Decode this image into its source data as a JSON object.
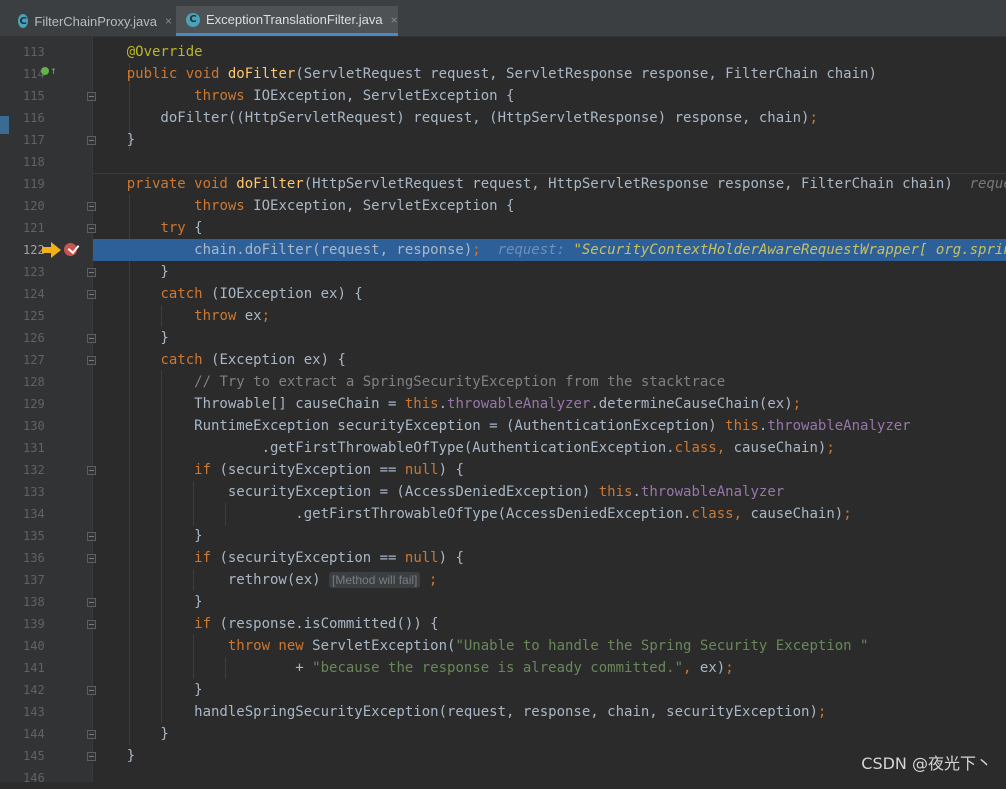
{
  "tabs": [
    {
      "label": "FilterChainProxy.java",
      "icon": "java-class-icon",
      "icon_letter": "C",
      "active": false
    },
    {
      "label": "ExceptionTranslationFilter.java",
      "icon": "java-class-icon",
      "icon_letter": "C",
      "active": true
    }
  ],
  "tab_close_glyph": "×",
  "editor": {
    "current_line": "122",
    "line_numbers": [
      "113",
      "114",
      "115",
      "116",
      "117",
      "118",
      "119",
      "120",
      "121",
      "122",
      "123",
      "124",
      "125",
      "126",
      "127",
      "128",
      "129",
      "130",
      "131",
      "132",
      "133",
      "134",
      "135",
      "136",
      "137",
      "138",
      "139",
      "140",
      "141",
      "142",
      "143",
      "144",
      "145",
      "146"
    ],
    "lines": [
      [
        {
          "t": "    ",
          "c": ""
        },
        {
          "t": "@Override",
          "c": "ann"
        }
      ],
      [
        {
          "t": "    ",
          "c": ""
        },
        {
          "t": "public void ",
          "c": "kw"
        },
        {
          "t": "doFilter",
          "c": "fn"
        },
        {
          "t": "(ServletRequest request, ServletResponse response, FilterChain chain)",
          "c": ""
        }
      ],
      [
        {
          "t": "            ",
          "c": ""
        },
        {
          "t": "throws ",
          "c": "kw"
        },
        {
          "t": "IOException, ServletException {",
          "c": ""
        }
      ],
      [
        {
          "t": "        doFilter((HttpServletRequest) request, (HttpServletResponse) response, chain)",
          "c": ""
        },
        {
          "t": ";",
          "c": "kw"
        }
      ],
      [
        {
          "t": "    }",
          "c": ""
        }
      ],
      [],
      [
        {
          "t": "    ",
          "c": ""
        },
        {
          "t": "private void ",
          "c": "kw"
        },
        {
          "t": "doFilter",
          "c": "fn"
        },
        {
          "t": "(HttpServletRequest request, HttpServletResponse response, FilterChain chain)  ",
          "c": ""
        },
        {
          "t": "request: ",
          "c": "hint"
        }
      ],
      [
        {
          "t": "            ",
          "c": ""
        },
        {
          "t": "throws ",
          "c": "kw"
        },
        {
          "t": "IOException, ServletException {",
          "c": ""
        }
      ],
      [
        {
          "t": "        ",
          "c": ""
        },
        {
          "t": "try ",
          "c": "kw"
        },
        {
          "t": "{",
          "c": ""
        }
      ],
      [
        {
          "t": "            chain.doFilter(request, response)",
          "c": ""
        },
        {
          "t": ";",
          "c": "kw"
        },
        {
          "t": "  ",
          "c": ""
        },
        {
          "t": "request: ",
          "c": "hint"
        },
        {
          "t": "\"SecurityContextHolderAwareRequestWrapper[ org.springframework",
          "c": "hintstr"
        }
      ],
      [
        {
          "t": "        }",
          "c": ""
        }
      ],
      [
        {
          "t": "        ",
          "c": ""
        },
        {
          "t": "catch ",
          "c": "kw"
        },
        {
          "t": "(IOException ex) {",
          "c": ""
        }
      ],
      [
        {
          "t": "            ",
          "c": ""
        },
        {
          "t": "throw ",
          "c": "kw"
        },
        {
          "t": "ex",
          "c": ""
        },
        {
          "t": ";",
          "c": "kw"
        }
      ],
      [
        {
          "t": "        }",
          "c": ""
        }
      ],
      [
        {
          "t": "        ",
          "c": ""
        },
        {
          "t": "catch ",
          "c": "kw"
        },
        {
          "t": "(Exception ex) {",
          "c": ""
        }
      ],
      [
        {
          "t": "            ",
          "c": ""
        },
        {
          "t": "// Try to extract a SpringSecurityException from the stacktrace",
          "c": "cmt"
        }
      ],
      [
        {
          "t": "            Throwable[] causeChain = ",
          "c": ""
        },
        {
          "t": "this",
          "c": "kw"
        },
        {
          "t": ".",
          "c": ""
        },
        {
          "t": "throwableAnalyzer",
          "c": "fld"
        },
        {
          "t": ".determineCauseChain(ex)",
          "c": ""
        },
        {
          "t": ";",
          "c": "kw"
        }
      ],
      [
        {
          "t": "            RuntimeException securityException = (AuthenticationException) ",
          "c": ""
        },
        {
          "t": "this",
          "c": "kw"
        },
        {
          "t": ".",
          "c": ""
        },
        {
          "t": "throwableAnalyzer",
          "c": "fld"
        }
      ],
      [
        {
          "t": "                    .getFirstThrowableOfType(AuthenticationException.",
          "c": ""
        },
        {
          "t": "class, ",
          "c": "kw"
        },
        {
          "t": "causeChain)",
          "c": ""
        },
        {
          "t": ";",
          "c": "kw"
        }
      ],
      [
        {
          "t": "            ",
          "c": ""
        },
        {
          "t": "if ",
          "c": "kw"
        },
        {
          "t": "(securityException == ",
          "c": ""
        },
        {
          "t": "null",
          "c": "kw"
        },
        {
          "t": ") {",
          "c": ""
        }
      ],
      [
        {
          "t": "                securityException = (AccessDeniedException) ",
          "c": ""
        },
        {
          "t": "this",
          "c": "kw"
        },
        {
          "t": ".",
          "c": ""
        },
        {
          "t": "throwableAnalyzer",
          "c": "fld"
        }
      ],
      [
        {
          "t": "                        .getFirstThrowableOfType(AccessDeniedException.",
          "c": ""
        },
        {
          "t": "class, ",
          "c": "kw"
        },
        {
          "t": "causeChain)",
          "c": ""
        },
        {
          "t": ";",
          "c": "kw"
        }
      ],
      [
        {
          "t": "            }",
          "c": ""
        }
      ],
      [
        {
          "t": "            ",
          "c": ""
        },
        {
          "t": "if ",
          "c": "kw"
        },
        {
          "t": "(securityException == ",
          "c": ""
        },
        {
          "t": "null",
          "c": "kw"
        },
        {
          "t": ") {",
          "c": ""
        }
      ],
      [
        {
          "t": "                rethrow(ex) ",
          "c": ""
        },
        {
          "t": "[Method will fail]",
          "c": "inlay"
        },
        {
          "t": " ",
          "c": ""
        },
        {
          "t": ";",
          "c": "kw"
        }
      ],
      [
        {
          "t": "            }",
          "c": ""
        }
      ],
      [
        {
          "t": "            ",
          "c": ""
        },
        {
          "t": "if ",
          "c": "kw"
        },
        {
          "t": "(response.isCommitted()) {",
          "c": ""
        }
      ],
      [
        {
          "t": "                ",
          "c": ""
        },
        {
          "t": "throw new ",
          "c": "kw"
        },
        {
          "t": "ServletException(",
          "c": ""
        },
        {
          "t": "\"Unable to handle the Spring Security Exception \"",
          "c": "str"
        }
      ],
      [
        {
          "t": "                        + ",
          "c": ""
        },
        {
          "t": "\"because the response is already committed.\"",
          "c": "str"
        },
        {
          "t": ", ",
          "c": "kw"
        },
        {
          "t": "ex)",
          "c": ""
        },
        {
          "t": ";",
          "c": "kw"
        }
      ],
      [
        {
          "t": "            }",
          "c": ""
        }
      ],
      [
        {
          "t": "            handleSpringSecurityException(request, response, chain, securityException)",
          "c": ""
        },
        {
          "t": ";",
          "c": "kw"
        }
      ],
      [
        {
          "t": "        }",
          "c": ""
        }
      ],
      [
        {
          "t": "    }",
          "c": ""
        }
      ],
      []
    ]
  },
  "watermark": "CSDN @夜光下丶",
  "colors": {
    "background": "#2b2b2b",
    "gutter": "#313335",
    "current_line": "#2d6099",
    "keyword": "#cc7832",
    "annotation": "#bbb529",
    "method": "#ffc66d",
    "field": "#9876aa",
    "string": "#6a8759",
    "comment": "#808080"
  }
}
